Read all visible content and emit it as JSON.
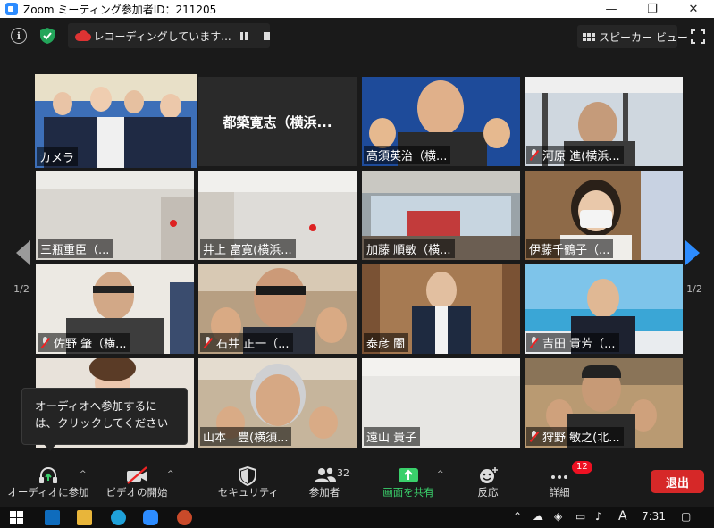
{
  "window": {
    "title": "Zoom ミーティング参加者ID：211205",
    "minimize": "—",
    "maximize": "❐",
    "close": "✕"
  },
  "topbar": {
    "info": "i",
    "recording_text": "レコーディングしています...",
    "speaker_view": "スピーカー ビュー"
  },
  "pager": {
    "left": "1/2",
    "right": "1/2"
  },
  "tiles": [
    {
      "name": "カメラ",
      "muted": false
    },
    {
      "name": "都築寛志（横浜...",
      "muted": false
    },
    {
      "name": "高須英治（横...",
      "muted": false
    },
    {
      "name": "河原 進(横浜...",
      "muted": true
    },
    {
      "name": "三瓶重臣（...",
      "muted": false
    },
    {
      "name": "井上 富寛(横浜...",
      "muted": false
    },
    {
      "name": "加藤 順敏（横...",
      "muted": false
    },
    {
      "name": "伊藤千鶴子（...",
      "muted": false
    },
    {
      "name": "佐野 肇（横...",
      "muted": true
    },
    {
      "name": "石井 正一（...",
      "muted": true
    },
    {
      "name": "泰彦 關",
      "muted": false
    },
    {
      "name": "吉田 貴芳（...",
      "muted": true
    },
    {
      "name": "",
      "muted": false
    },
    {
      "name": "山本　豊(横須...",
      "muted": false
    },
    {
      "name": "遠山 貴子",
      "muted": false
    },
    {
      "name": "狩野 敏之(北...",
      "muted": true
    }
  ],
  "tooltip": "オーディオへ参加するには、クリックしてください",
  "toolbar": {
    "audio": "オーディオに参加",
    "video": "ビデオの開始",
    "security": "セキュリティ",
    "participants": "参加者",
    "participants_count": "32",
    "share": "画面を共有",
    "reactions": "反応",
    "more": "詳細",
    "more_badge": "12",
    "end": "退出",
    "caret": "^"
  },
  "taskbar": {
    "ime": "A",
    "time": "7:31"
  },
  "colors": {
    "active_speaker": "#cfe43c",
    "share_green": "#3ad06b",
    "end_red": "#d62828",
    "zoom_blue": "#2d8cff"
  }
}
